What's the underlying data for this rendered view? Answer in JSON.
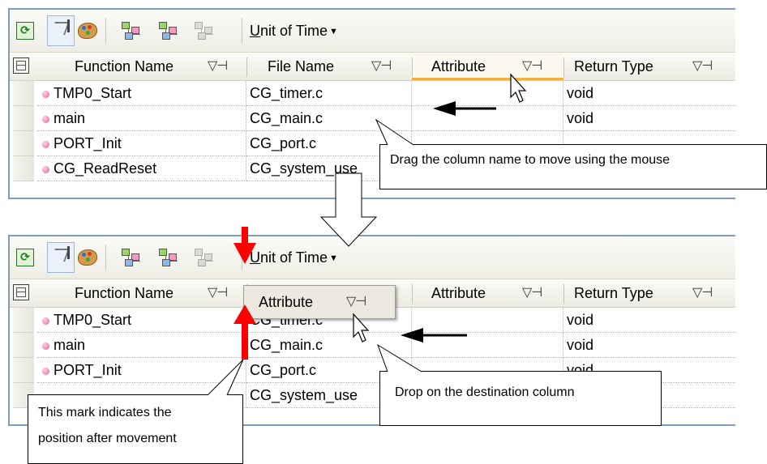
{
  "toolbar": {
    "unit_label": "Unit of Time",
    "unit_underline": "U",
    "unit_rest": "nit of Time"
  },
  "top": {
    "columns": [
      "Function Name",
      "File Name",
      "Attribute",
      "Return Type"
    ],
    "rows": [
      {
        "fn": "TMP0_Start",
        "file": "CG_timer.c",
        "attr": "",
        "ret": "void"
      },
      {
        "fn": "main",
        "file": "CG_main.c",
        "attr": "",
        "ret": "void"
      },
      {
        "fn": "PORT_Init",
        "file": "CG_port.c",
        "attr": "",
        "ret": ""
      },
      {
        "fn": "CG_ReadReset",
        "file": "CG_system_use",
        "attr": "",
        "ret": ""
      }
    ]
  },
  "bottom": {
    "columns": [
      "Function Name",
      "File Name",
      "Attribute",
      "Return Type"
    ],
    "rows": [
      {
        "fn": "TMP0_Start",
        "file": "CG_timer.c",
        "attr": "",
        "ret": "void"
      },
      {
        "fn": "main",
        "file": "CG_main.c",
        "attr": "",
        "ret": "void"
      },
      {
        "fn": "PORT_Init",
        "file": "CG_port.c",
        "attr": "",
        "ret": "void"
      },
      {
        "fn": "",
        "file": "CG_system_use",
        "attr": "",
        "ret": ""
      }
    ],
    "drag_ghost": "Attribute"
  },
  "callouts": {
    "drag": "Drag the column name to move using the mouse",
    "drop": "Drop on the destination column",
    "mark_line1": "This mark indicates the",
    "mark_line2": "position after movement"
  },
  "icons": {
    "filter": "funnel-icon",
    "pin": "pin-icon",
    "refresh": "refresh-icon",
    "sort": "sort-icon",
    "palette": "palette-icon",
    "tree": "tree-icon"
  },
  "colors": {
    "accent_orange": "#f2b13f",
    "panel_border": "#7f9db9",
    "marker_red": "#ff0000"
  }
}
